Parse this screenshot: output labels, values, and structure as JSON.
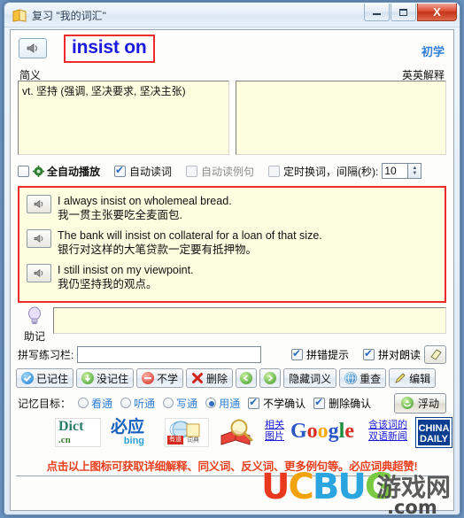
{
  "window": {
    "title": "复习 \"我的词汇\"",
    "icon": "book-icon",
    "buttons": {
      "minimize": "–",
      "maximize": "□",
      "close": "X"
    }
  },
  "word": {
    "text": "insist on",
    "level": "初学",
    "speaker_icon": "speaker-icon"
  },
  "definition": {
    "cn_label": "简义",
    "en_label": "英英解释",
    "cn_text": "vt. 坚持 (强调, 坚决要求, 坚决主张)",
    "en_text": ""
  },
  "options": {
    "auto_play": {
      "label": "全自动播放",
      "checked": false,
      "icon": "gear-icon"
    },
    "auto_read_word": {
      "label": "自动读词",
      "checked": true
    },
    "auto_read_sentence": {
      "label": "自动读例句",
      "checked": false
    },
    "timed_switch": {
      "label": "定时换词，间隔(秒):",
      "checked": false
    },
    "interval_value": "10"
  },
  "examples": [
    {
      "en": "I always insist on wholemeal bread.",
      "cn": "我一贯主张要吃全麦面包."
    },
    {
      "en": "The bank will insist on collateral for a loan of that size.",
      "cn": "银行对这样的大笔贷款一定要有抵押物。"
    },
    {
      "en": "I still insist on my viewpoint.",
      "cn": "我仍坚持我的观点。"
    }
  ],
  "mnemonic": {
    "label": "助记",
    "icon": "lightbulb-icon",
    "value": ""
  },
  "spelling": {
    "label": "拼写练习栏:",
    "value": "",
    "wrong_hint": {
      "label": "拼错提示",
      "checked": true
    },
    "right_read": {
      "label": "拼对朗读",
      "checked": true
    },
    "eraser_icon": "eraser-icon"
  },
  "toolbar": [
    {
      "label": "已记住",
      "icon": "blue-check-icon"
    },
    {
      "label": "没记住",
      "icon": "green-down-arrow-icon"
    },
    {
      "label": "不学",
      "icon": "red-minus-icon"
    },
    {
      "label": "删除",
      "icon": "red-x-icon"
    },
    {
      "label": "",
      "icon": "green-left-arrow-icon"
    },
    {
      "label": "",
      "icon": "green-right-arrow-icon"
    },
    {
      "label": "隐藏词义",
      "icon": ""
    },
    {
      "label": "重查",
      "icon": "globe-icon"
    },
    {
      "label": "编辑",
      "icon": "pencil-icon"
    }
  ],
  "goal": {
    "label": "记忆目标：",
    "radios": [
      {
        "label": "看通",
        "selected": false
      },
      {
        "label": "听通",
        "selected": false
      },
      {
        "label": "写通",
        "selected": false
      },
      {
        "label": "用通",
        "selected": true
      }
    ],
    "confirm_skip": {
      "label": "不学确认",
      "checked": true
    },
    "confirm_delete": {
      "label": "删除确认",
      "checked": true
    },
    "float_button": {
      "label": "浮动",
      "icon": "green-refresh-icon"
    }
  },
  "links": [
    {
      "name": "dict-cn",
      "line1": "Dict",
      "line2": ".cn"
    },
    {
      "name": "bing",
      "line1": "必应",
      "line2": "bing"
    },
    {
      "name": "youdao",
      "line1": "有道",
      "line2": "词典"
    },
    {
      "name": "magnifier-book",
      "line1": "",
      "line2": ""
    },
    {
      "name": "related-images",
      "line1": "相关",
      "line2": "图片"
    },
    {
      "name": "google",
      "line1": "Google",
      "line2": ""
    },
    {
      "name": "bilingual-news",
      "line1": "含该词的",
      "line2": "双语新闻"
    },
    {
      "name": "china-daily",
      "line1": "CHINA",
      "line2": "DAILY"
    }
  ],
  "caption": "点击以上图标可获取详细解释、同义词、反义词、更多例句等。必应词典超赞!",
  "watermark": {
    "ucbug": "UCBUG",
    "cn": "游戏网",
    "com": ".com"
  },
  "colors": {
    "accent_blue": "#1a1ae0",
    "level_blue": "#2f7fd6",
    "highlight_red": "#ef2b2b",
    "panel_cream": "#fdfddf",
    "caption_red": "#e8401f"
  }
}
